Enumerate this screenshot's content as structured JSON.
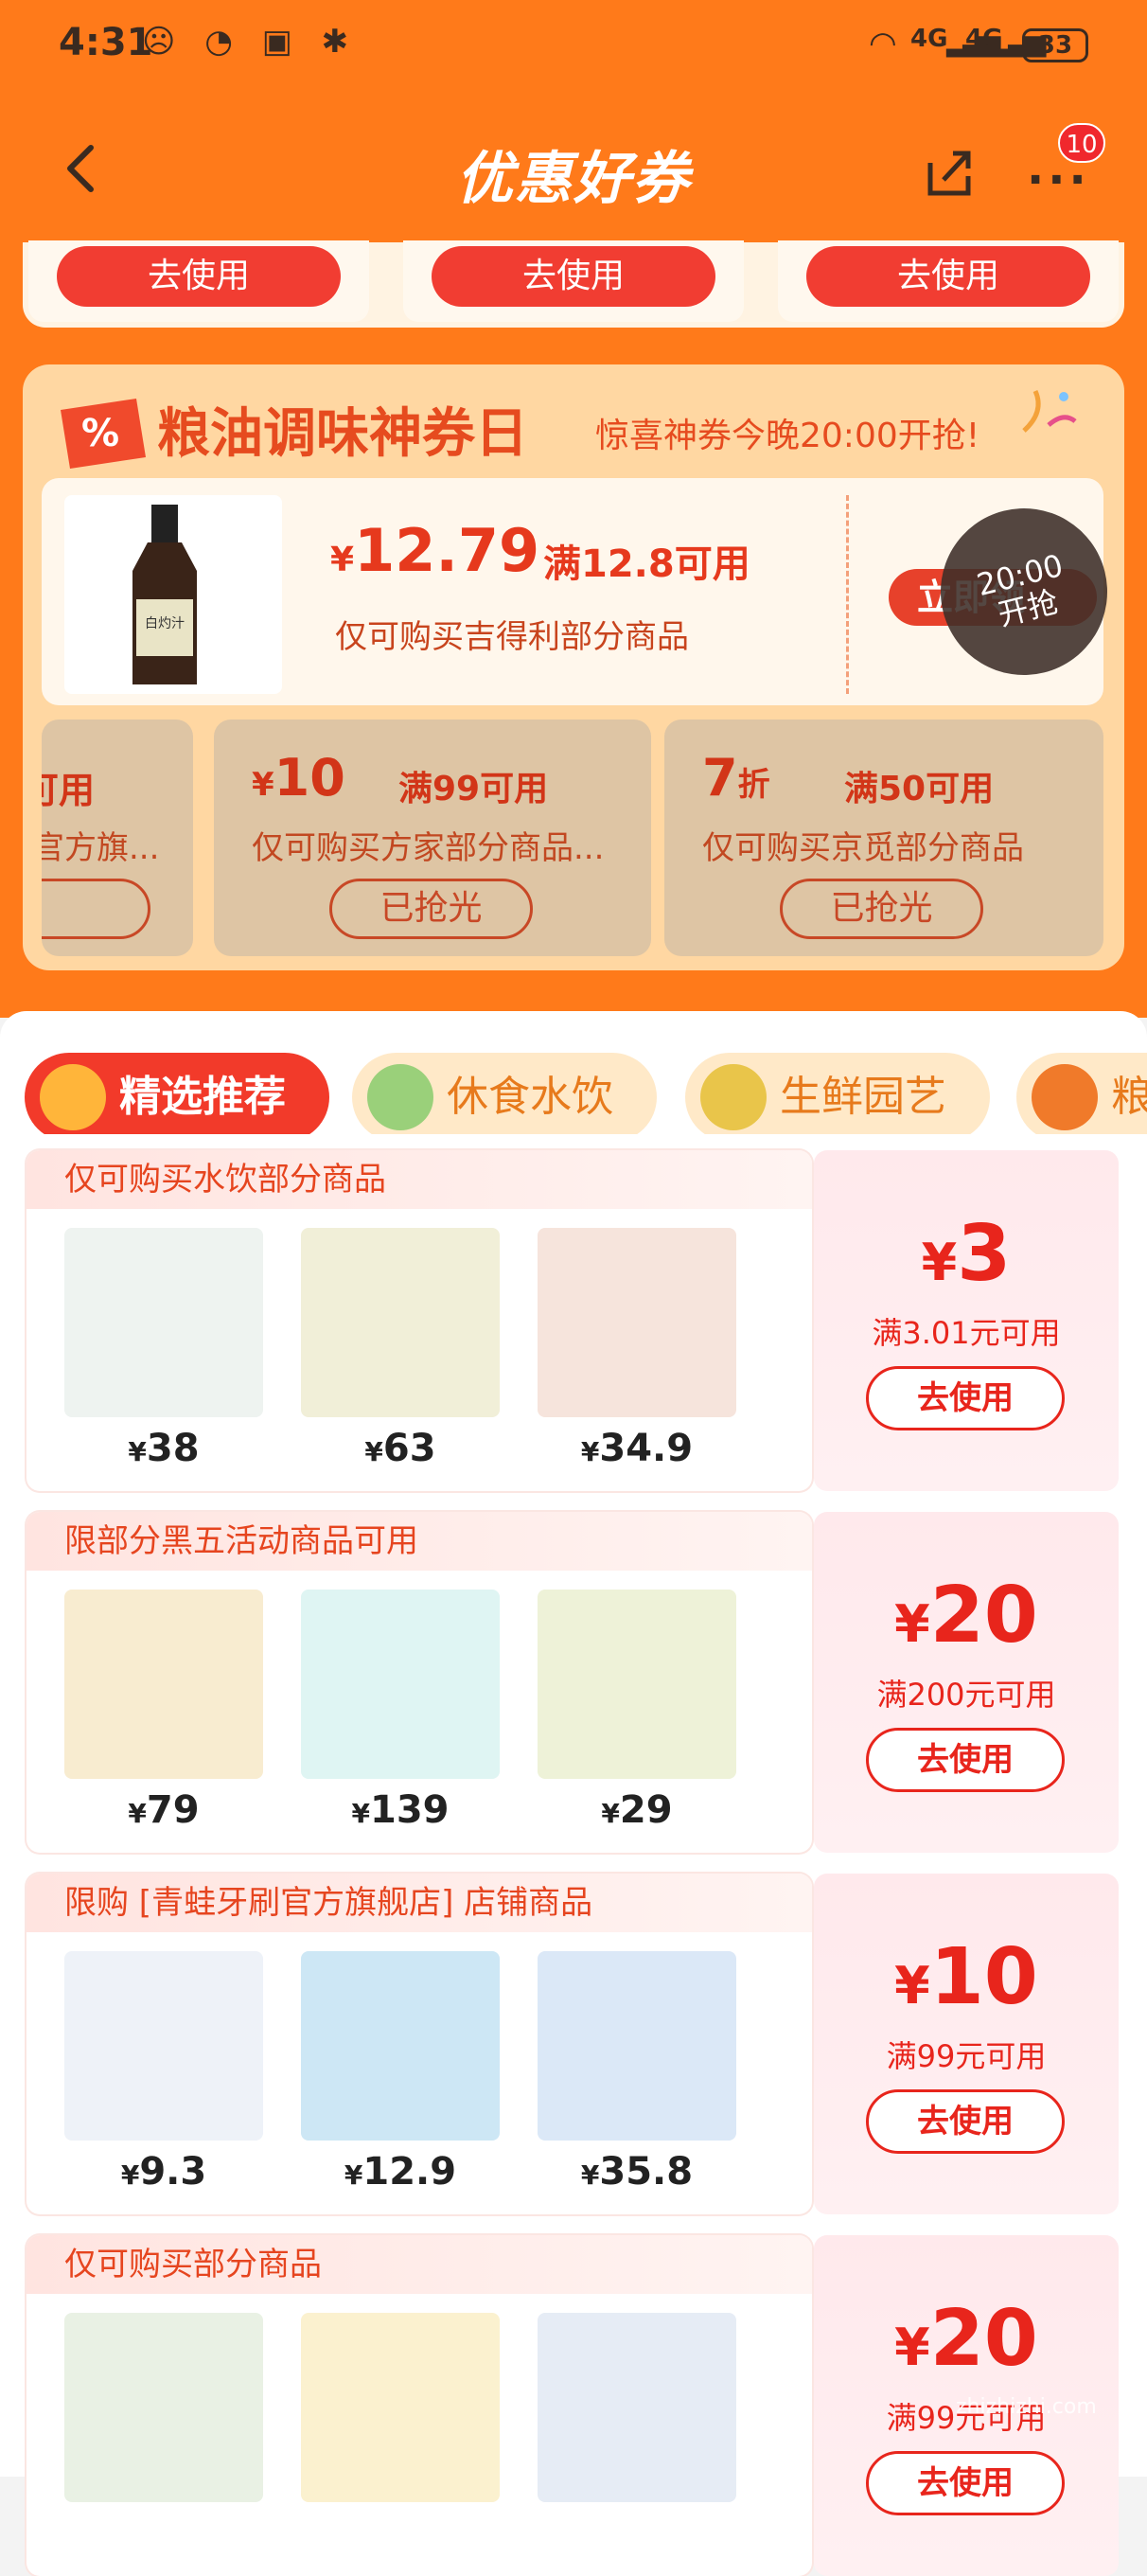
{
  "status_bar": {
    "time": "4:31",
    "network_1": "4G",
    "network_2": "4G",
    "battery": "33"
  },
  "header": {
    "title": "优惠好券",
    "more_badge": "10"
  },
  "top_coupons": {
    "use_labels": [
      "去使用",
      "去使用",
      "去使用"
    ]
  },
  "promo": {
    "title": "粮油调味神券日",
    "subtitle": "惊喜神券今晚20:00开抢!",
    "main": {
      "currency": "¥",
      "amount": "12.79",
      "condition": "满12.8可用",
      "description": "仅可购买吉得利部分商品",
      "grab_button": "立即领",
      "timer_time": "20:00",
      "timer_label": "开抢"
    },
    "coupons": [
      {
        "amount_part": "可用",
        "desc": "官方旗...",
        "sold": ""
      },
      {
        "currency": "¥",
        "amount": "10",
        "condition": "满99可用",
        "desc": "仅可购买方家部分商品...",
        "sold": "已抢光"
      },
      {
        "amount": "7",
        "unit": "折",
        "condition": "满50可用",
        "desc": "仅可购买京觅部分商品",
        "sold": "已抢光"
      }
    ]
  },
  "tabs": [
    {
      "label": "精选推荐",
      "active": true
    },
    {
      "label": "休食水饮",
      "active": false
    },
    {
      "label": "生鲜园艺",
      "active": false
    },
    {
      "label": "粮",
      "active": false
    }
  ],
  "cards": [
    {
      "header": "仅可购买水饮部分商品",
      "items": [
        {
          "price": "38"
        },
        {
          "price": "63"
        },
        {
          "price": "34.9"
        }
      ],
      "amount": "3",
      "condition": "满3.01元可用",
      "button": "去使用"
    },
    {
      "header": "限部分黑五活动商品可用",
      "items": [
        {
          "price": "79"
        },
        {
          "price": "139"
        },
        {
          "price": "29"
        }
      ],
      "amount": "20",
      "condition": "满200元可用",
      "button": "去使用"
    },
    {
      "header": "限购 [青蛙牙刷官方旗舰店] 店铺商品",
      "items": [
        {
          "price": "9.3"
        },
        {
          "price": "12.9"
        },
        {
          "price": "35.8"
        }
      ],
      "amount": "10",
      "condition": "满99元可用",
      "button": "去使用"
    },
    {
      "header": "仅可购买部分商品",
      "items": [
        {
          "price": ""
        },
        {
          "price": ""
        },
        {
          "price": ""
        }
      ],
      "amount": "20",
      "condition": "满99元可用",
      "button": "去使用"
    }
  ],
  "currency_symbol": "¥",
  "watermark": "zhizhizhi.com",
  "colors": {
    "brand_orange": "#ff7a1a",
    "coupon_red": "#e8251c"
  }
}
